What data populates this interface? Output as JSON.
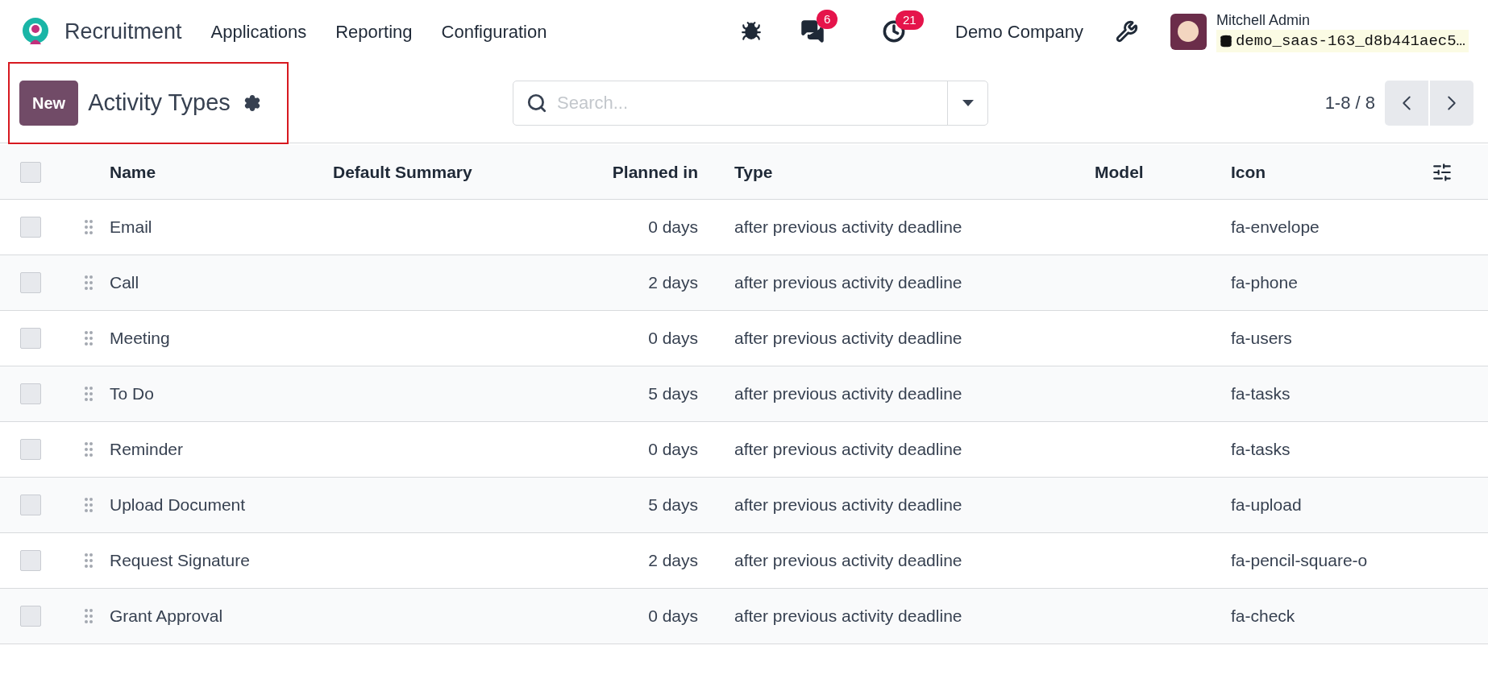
{
  "navbar": {
    "app_name": "Recruitment",
    "menu": [
      "Applications",
      "Reporting",
      "Configuration"
    ],
    "messages_badge": "6",
    "activities_badge": "21",
    "company": "Demo Company",
    "user_name": "Mitchell Admin",
    "database": "demo_saas-163_d8b441aec5…"
  },
  "control_panel": {
    "highlighted": true,
    "new_button": "New",
    "title": "Activity Types",
    "search": {
      "placeholder": "Search..."
    },
    "pager": "1-8 / 8"
  },
  "table": {
    "select_all": {
      "checked": false
    },
    "columns": [
      "Name",
      "Default Summary",
      "Planned in",
      "Type",
      "Model",
      "Icon"
    ],
    "rows": [
      {
        "checked": false,
        "name": "Email",
        "planned_in": "0 days",
        "type": "after previous activity deadline",
        "icon": "fa-envelope"
      },
      {
        "checked": false,
        "name": "Call",
        "planned_in": "2 days",
        "type": "after previous activity deadline",
        "icon": "fa-phone"
      },
      {
        "checked": false,
        "name": "Meeting",
        "planned_in": "0 days",
        "type": "after previous activity deadline",
        "icon": "fa-users"
      },
      {
        "checked": false,
        "name": "To Do",
        "planned_in": "5 days",
        "type": "after previous activity deadline",
        "icon": "fa-tasks"
      },
      {
        "checked": false,
        "name": "Reminder",
        "planned_in": "0 days",
        "type": "after previous activity deadline",
        "icon": "fa-tasks"
      },
      {
        "checked": false,
        "name": "Upload Document",
        "planned_in": "5 days",
        "type": "after previous activity deadline",
        "icon": "fa-upload"
      },
      {
        "checked": false,
        "name": "Request Signature",
        "planned_in": "2 days",
        "type": "after previous activity deadline",
        "icon": "fa-pencil-square-o"
      },
      {
        "checked": false,
        "name": "Grant Approval",
        "planned_in": "0 days",
        "type": "after previous activity deadline",
        "icon": "fa-check"
      }
    ]
  }
}
